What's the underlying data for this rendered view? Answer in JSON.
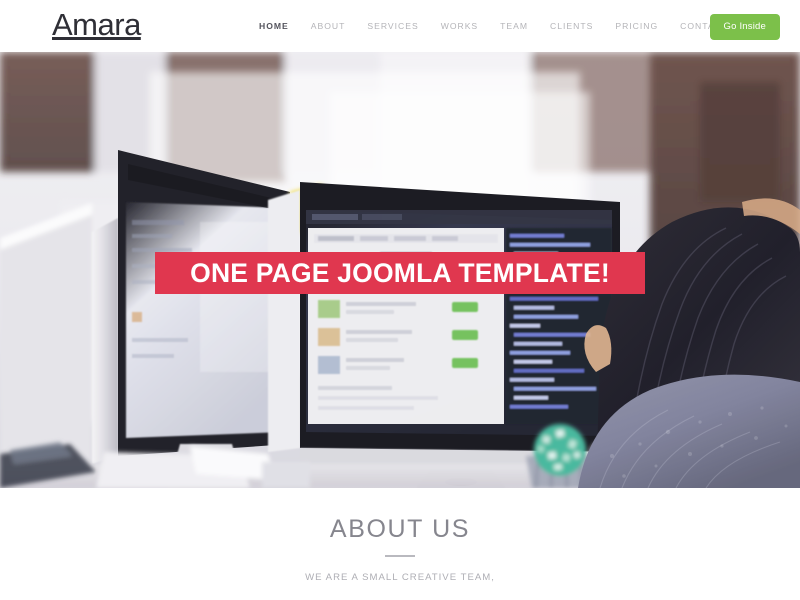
{
  "header": {
    "logo": "Amara",
    "nav": [
      {
        "label": "HOME",
        "active": true
      },
      {
        "label": "ABOUT",
        "active": false
      },
      {
        "label": "SERVICES",
        "active": false
      },
      {
        "label": "WORKS",
        "active": false
      },
      {
        "label": "TEAM",
        "active": false
      },
      {
        "label": "CLIENTS",
        "active": false
      },
      {
        "label": "PRICING",
        "active": false
      },
      {
        "label": "CONTACT",
        "active": false
      }
    ],
    "cta_label": "Go Inside",
    "cta_color": "#7cc04a"
  },
  "hero": {
    "banner_text": "ONE PAGE JOOMLA TEMPLATE!",
    "banner_color": "#e0374f",
    "banner_text_color": "#ffffff",
    "scene": "woman seated from behind at an office desk facing an iMac monitor displaying code, second iMac at left, brick wall and bright windows in background"
  },
  "about": {
    "title": "ABOUT US",
    "subtitle": "WE ARE A SMALL CREATIVE TEAM,",
    "title_color": "#86868e"
  }
}
